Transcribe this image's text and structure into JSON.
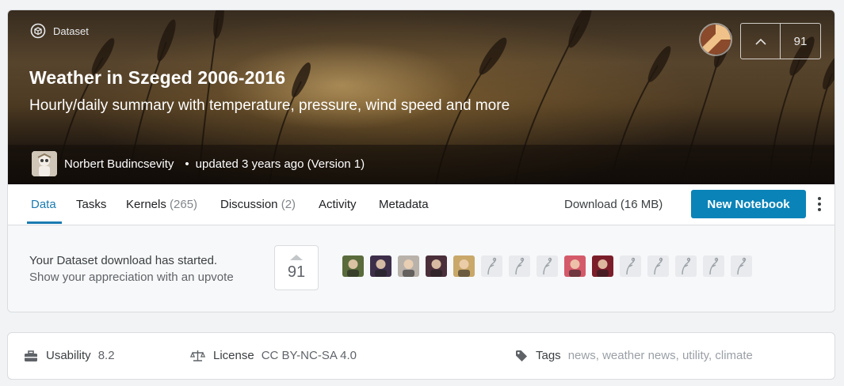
{
  "hero": {
    "type_label": "Dataset",
    "title": "Weather in Szeged 2006-2016",
    "subtitle": "Hourly/daily summary with temperature, pressure, wind speed and more",
    "author": "Norbert Budincsevity",
    "updated": "updated 3 years ago (Version 1)",
    "upvotes": "91"
  },
  "tabs": [
    {
      "label": "Data",
      "count": ""
    },
    {
      "label": "Tasks",
      "count": ""
    },
    {
      "label": "Kernels",
      "count": "(265)"
    },
    {
      "label": "Discussion",
      "count": "(2)"
    },
    {
      "label": "Activity",
      "count": ""
    },
    {
      "label": "Metadata",
      "count": ""
    }
  ],
  "actions": {
    "download": "Download (16 MB)",
    "new_notebook": "New Notebook"
  },
  "appreciation": {
    "line1": "Your Dataset download has started.",
    "line2": "Show your appreciation with an upvote",
    "votes": "91"
  },
  "voters": [
    "photo",
    "photo",
    "photo",
    "photo",
    "photo",
    "default",
    "default",
    "default",
    "photo",
    "photo",
    "default",
    "default",
    "default",
    "default",
    "default"
  ],
  "meta": {
    "usability_label": "Usability",
    "usability_value": "8.2",
    "license_label": "License",
    "license_value": "CC BY-NC-SA 4.0",
    "tags_label": "Tags",
    "tags": [
      "news",
      "weather news",
      "utility",
      "climate"
    ]
  },
  "colors": {
    "accent": "#1a7bb0",
    "button": "#0a83b8"
  }
}
